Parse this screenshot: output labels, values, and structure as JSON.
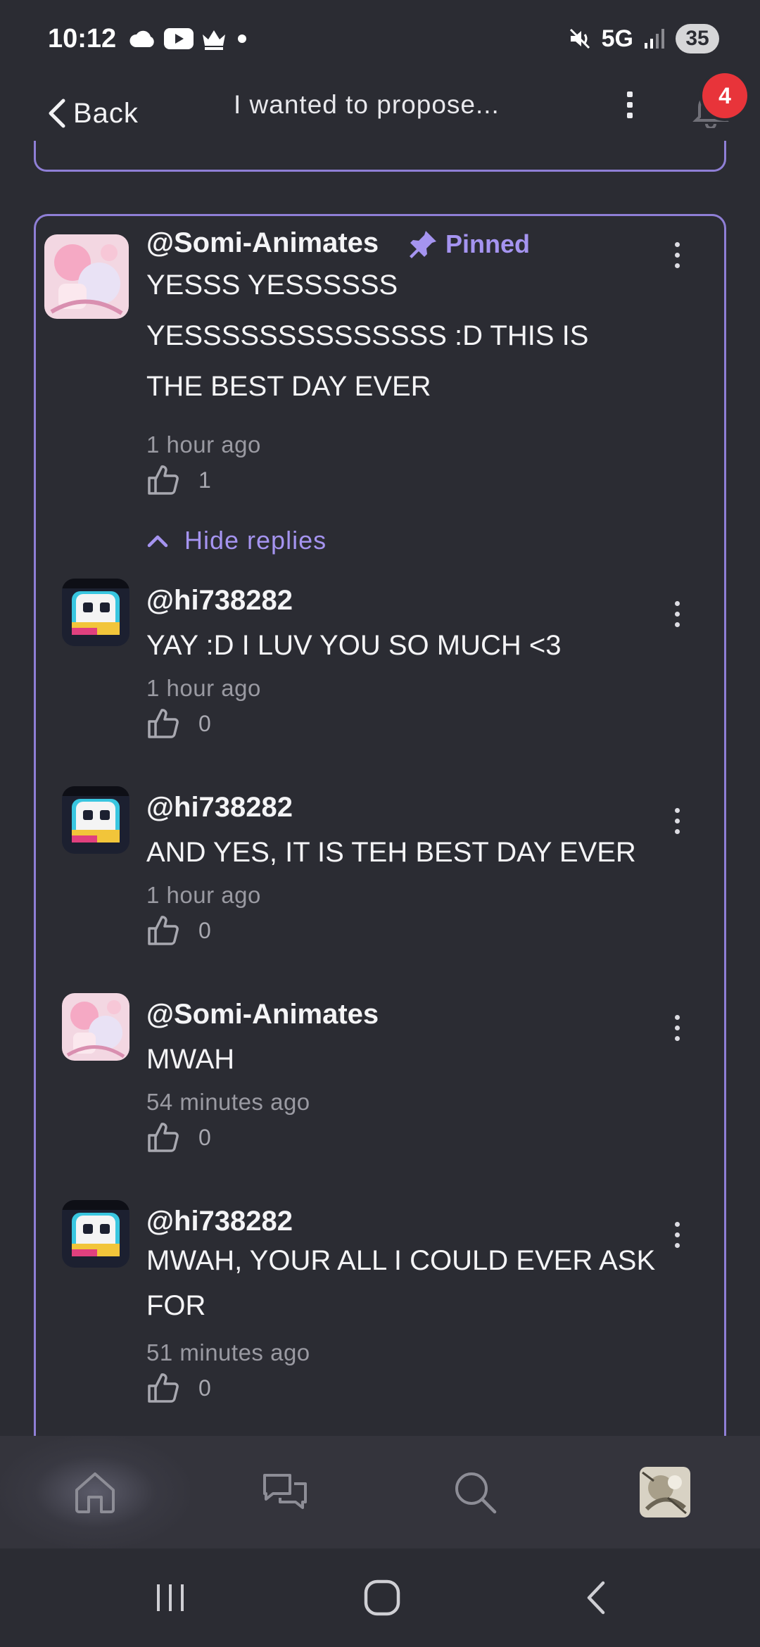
{
  "status_bar": {
    "time": "10:12",
    "network": "5G",
    "battery": "35"
  },
  "header": {
    "back_label": "Back",
    "title": "I wanted to propose...",
    "notification_count": "4"
  },
  "comment": {
    "username": "@Somi-Animates",
    "pinned_label": "Pinned",
    "text": "YESSS YESSSSSS YESSSSSSSSSSSSSS :D THIS IS THE BEST DAY EVER",
    "time": "1 hour ago",
    "likes": "1",
    "hide_replies_label": "Hide replies"
  },
  "replies": [
    {
      "username": "@hi738282",
      "text": "YAY :D I LUV YOU SO MUCH <3",
      "time": "1 hour ago",
      "likes": "0"
    },
    {
      "username": "@hi738282",
      "text": "AND YES, IT IS TEH BEST DAY EVER",
      "time": "1 hour ago",
      "likes": "0"
    },
    {
      "username": "@Somi-Animates",
      "text": "MWAH",
      "time": "54 minutes ago",
      "likes": "0"
    },
    {
      "username": "@hi738282",
      "text": "MWAH, YOUR ALL I COULD EVER ASK FOR",
      "time": "51 minutes ago",
      "likes": "0"
    }
  ],
  "bottom_nav": {
    "items": [
      "home-icon",
      "chat-icon",
      "search-icon",
      "profile-avatar"
    ]
  },
  "colors": {
    "background": "#2b2c33",
    "accent": "#a594f0",
    "card_border": "#8f7fd6",
    "badge": "#e8343a"
  }
}
